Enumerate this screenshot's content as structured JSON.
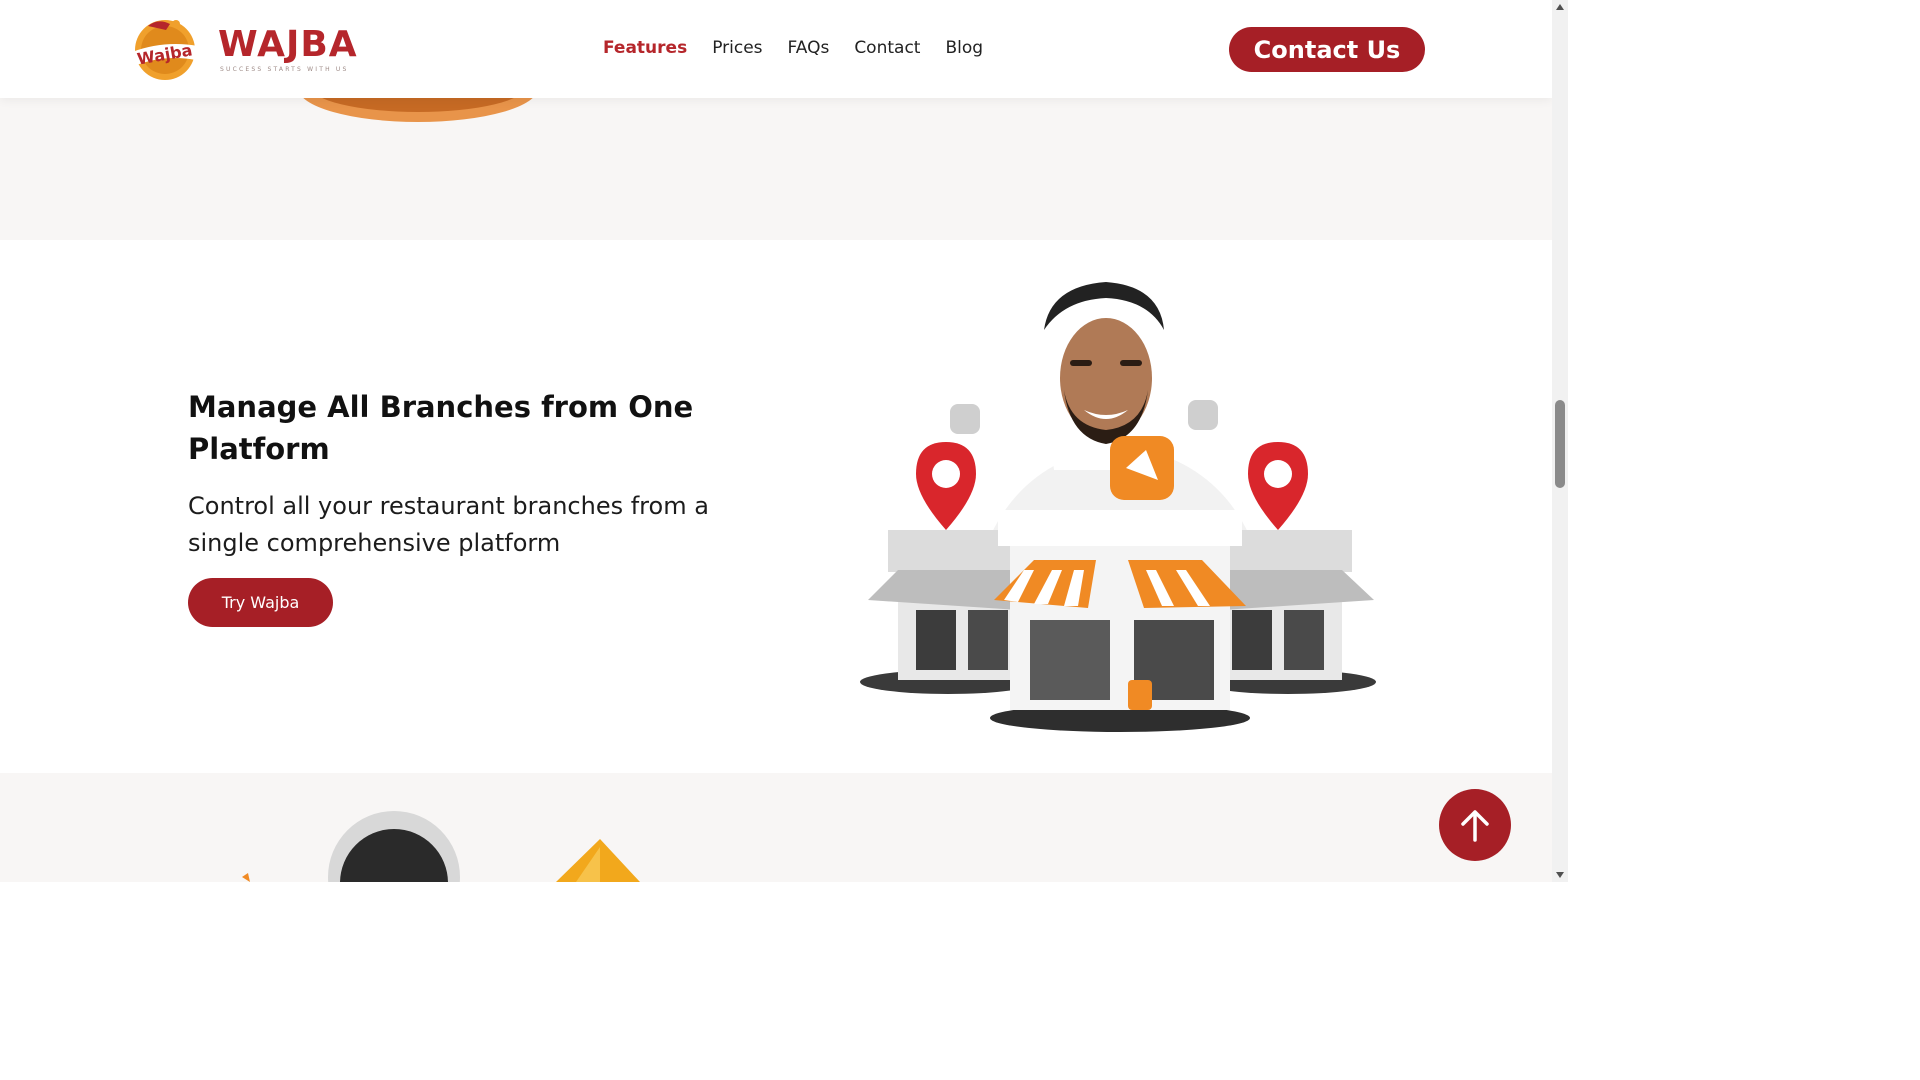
{
  "brand": {
    "name": "WAJBA",
    "badge_text": "Wajba",
    "tagline": "SUCCESS STARTS WITH US",
    "color": "#b5262b"
  },
  "nav": {
    "items": [
      {
        "label": "Features",
        "active": true
      },
      {
        "label": "Prices",
        "active": false
      },
      {
        "label": "FAQs",
        "active": false
      },
      {
        "label": "Contact",
        "active": false
      },
      {
        "label": "Blog",
        "active": false
      }
    ]
  },
  "header": {
    "contact_label": "Contact Us"
  },
  "feature": {
    "title": "Manage All Branches from One Platform",
    "description": "Control all your restaurant branches from a single comprehensive platform",
    "cta_label": "Try Wajba",
    "illustration": "branches-illustration"
  },
  "icons": {
    "scroll_top": "arrow-up-icon"
  },
  "colors": {
    "primary": "#a61f26",
    "accent_orange": "#f08a24",
    "section_bg": "#f8f6f5"
  }
}
